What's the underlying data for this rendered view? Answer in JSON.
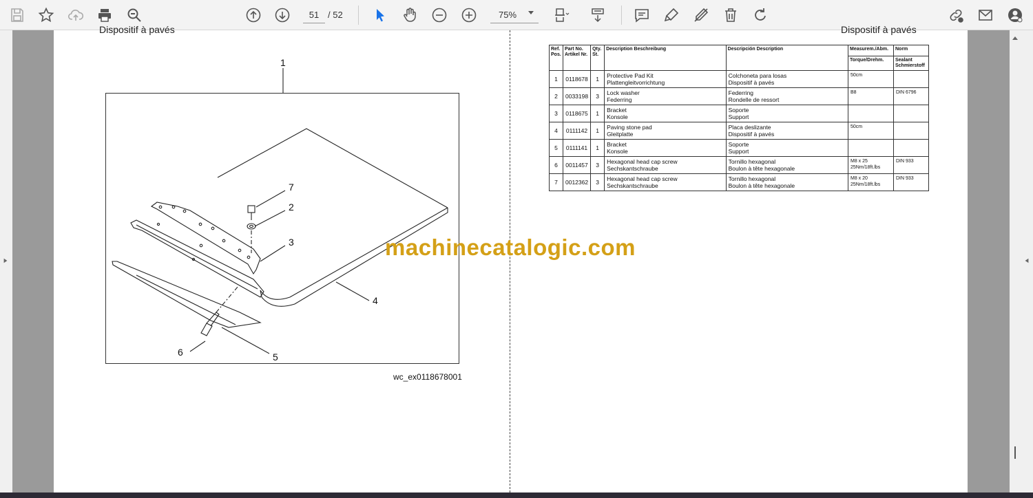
{
  "toolbar": {
    "page_current": "51",
    "page_total": "/ 52",
    "zoom": "75%"
  },
  "document": {
    "left_header": "Dispositif à pavés",
    "right_header": "Dispositif à pavés",
    "figure_code": "wc_ex0118678001",
    "callouts": [
      "1",
      "2",
      "3",
      "4",
      "5",
      "6",
      "7"
    ],
    "watermark": "machinecatalogic.com"
  },
  "parts_table": {
    "headers": {
      "ref": "Ref. Pos.",
      "part_no": "Part No. Artikel Nr.",
      "qty": "Qty. St.",
      "desc_en_de": "Description Beschreibung",
      "desc_es_fr": "Descripción Description",
      "measure": "Measurem./Abm.",
      "torque": "Torque/Drehm.",
      "norm": "Norm",
      "sealant": "Sealant Schmierstoff"
    },
    "rows": [
      {
        "ref": "1",
        "part": "0118678",
        "qty": "1",
        "en": "Protective Pad Kit",
        "de": "Plattengleitvorrichtung",
        "es": "Colchoneta para losas",
        "fr": "Dispositif à pavés",
        "meas": "50cm",
        "torque": "",
        "norm": ""
      },
      {
        "ref": "2",
        "part": "0033198",
        "qty": "3",
        "en": "Lock washer",
        "de": "Federring",
        "es": "Federring",
        "fr": "Rondelle de ressort",
        "meas": "B8",
        "torque": "",
        "norm": "DIN 6796"
      },
      {
        "ref": "3",
        "part": "0118675",
        "qty": "1",
        "en": "Bracket",
        "de": "Konsole",
        "es": "Soporte",
        "fr": "Support",
        "meas": "",
        "torque": "",
        "norm": ""
      },
      {
        "ref": "4",
        "part": "0111142",
        "qty": "1",
        "en": "Paving stone pad",
        "de": "Gleitplatte",
        "es": "Placa deslizante",
        "fr": "Dispositif à pavés",
        "meas": "50cm",
        "torque": "",
        "norm": ""
      },
      {
        "ref": "5",
        "part": "0111141",
        "qty": "1",
        "en": "Bracket",
        "de": "Konsole",
        "es": "Soporte",
        "fr": "Support",
        "meas": "",
        "torque": "",
        "norm": ""
      },
      {
        "ref": "6",
        "part": "0011457",
        "qty": "3",
        "en": "Hexagonal head cap screw",
        "de": "Sechskantschraube",
        "es": "Tornillo hexagonal",
        "fr": "Boulon à tête hexagonale",
        "meas": "M8 x 25",
        "torque": "25Nm/18ft.lbs",
        "norm": "DIN 933"
      },
      {
        "ref": "7",
        "part": "0012362",
        "qty": "3",
        "en": "Hexagonal head cap screw",
        "de": "Sechskantschraube",
        "es": "Tornillo hexagonal",
        "fr": "Boulon à tête hexagonale",
        "meas": "M8 x 20",
        "torque": "25Nm/18ft.lbs",
        "norm": "DIN 933"
      }
    ]
  }
}
